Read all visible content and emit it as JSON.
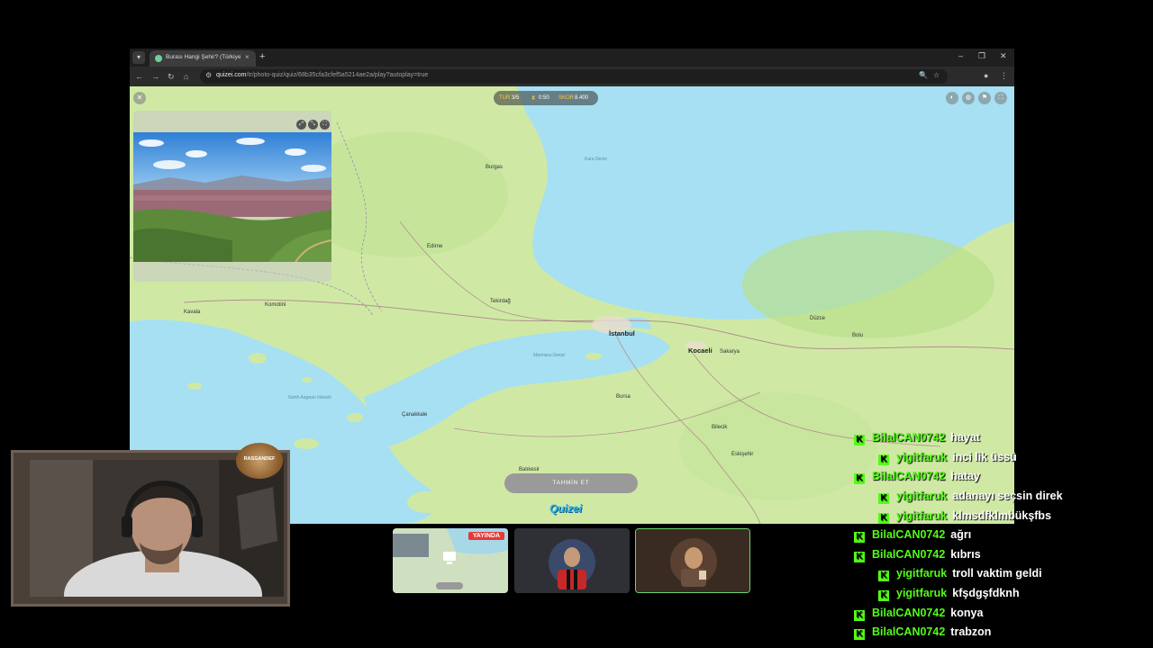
{
  "browser": {
    "tab_title": "Burası Hangi Şehir? (Türkiye) - Q",
    "tab_close": "×",
    "new_tab": "+",
    "url_domain": "quizei.com",
    "url_path": "/tr/photo-quiz/quiz/68b35cfa3cfef5a5214ae2a/play?autoplay=true",
    "window_controls": [
      "–",
      "❐",
      "✕"
    ]
  },
  "hud": {
    "round_label": "TUR",
    "round_value": "3/5",
    "time_value": "0:50",
    "score_label": "SKOR",
    "score_value": "8.400"
  },
  "map": {
    "cities": [
      {
        "name": "İstanbul",
        "big": true
      },
      {
        "name": "Kocaeli",
        "big": true
      },
      {
        "name": "Sakarya",
        "big": false
      },
      {
        "name": "Burgas",
        "big": false
      },
      {
        "name": "Edirne",
        "big": false
      },
      {
        "name": "Tekirdağ",
        "big": false
      },
      {
        "name": "Çanakkale",
        "big": false
      },
      {
        "name": "Bursa",
        "big": false
      },
      {
        "name": "Balıkesir",
        "big": false
      },
      {
        "name": "Eskişehir",
        "big": false
      },
      {
        "name": "Bilecik",
        "big": false
      },
      {
        "name": "Düzce",
        "big": false
      },
      {
        "name": "Bolu",
        "big": false
      },
      {
        "name": "Kavala",
        "big": false
      },
      {
        "name": "Komotini",
        "big": false
      }
    ],
    "seas": [
      "Kara Deniz",
      "Marmara Denizi",
      "North Aegean Islands"
    ]
  },
  "guess_button": "TAHMİN ET",
  "logo": "Quizei",
  "stream": {
    "live_badge": "YAYINDA",
    "channel_badge": "RASGANDEF"
  },
  "chat": [
    {
      "user": "BilalCAN0742",
      "text": "hayat"
    },
    {
      "user": "yigitfaruk",
      "text": "inci lik üssü"
    },
    {
      "user": "BilalCAN0742",
      "text": "hatay"
    },
    {
      "user": "yigitfaruk",
      "text": "adanayı seçsin direk"
    },
    {
      "user": "yigitfaruk",
      "text": "klmsdfklmbükşfbs"
    },
    {
      "user": "BilalCAN0742",
      "text": "ağrı"
    },
    {
      "user": "BilalCAN0742",
      "text": "kıbrıs"
    },
    {
      "user": "yigitfaruk",
      "text": "troll vaktim geldi"
    },
    {
      "user": "yigitfaruk",
      "text": "kfşdgşfdknh"
    },
    {
      "user": "BilalCAN0742",
      "text": "konya"
    },
    {
      "user": "BilalCAN0742",
      "text": "trabzon"
    }
  ],
  "colors": {
    "chat_user": "#53fc18",
    "sea": "#a6e0f2",
    "land": "#cfe9a5",
    "live_red": "#e53935"
  }
}
